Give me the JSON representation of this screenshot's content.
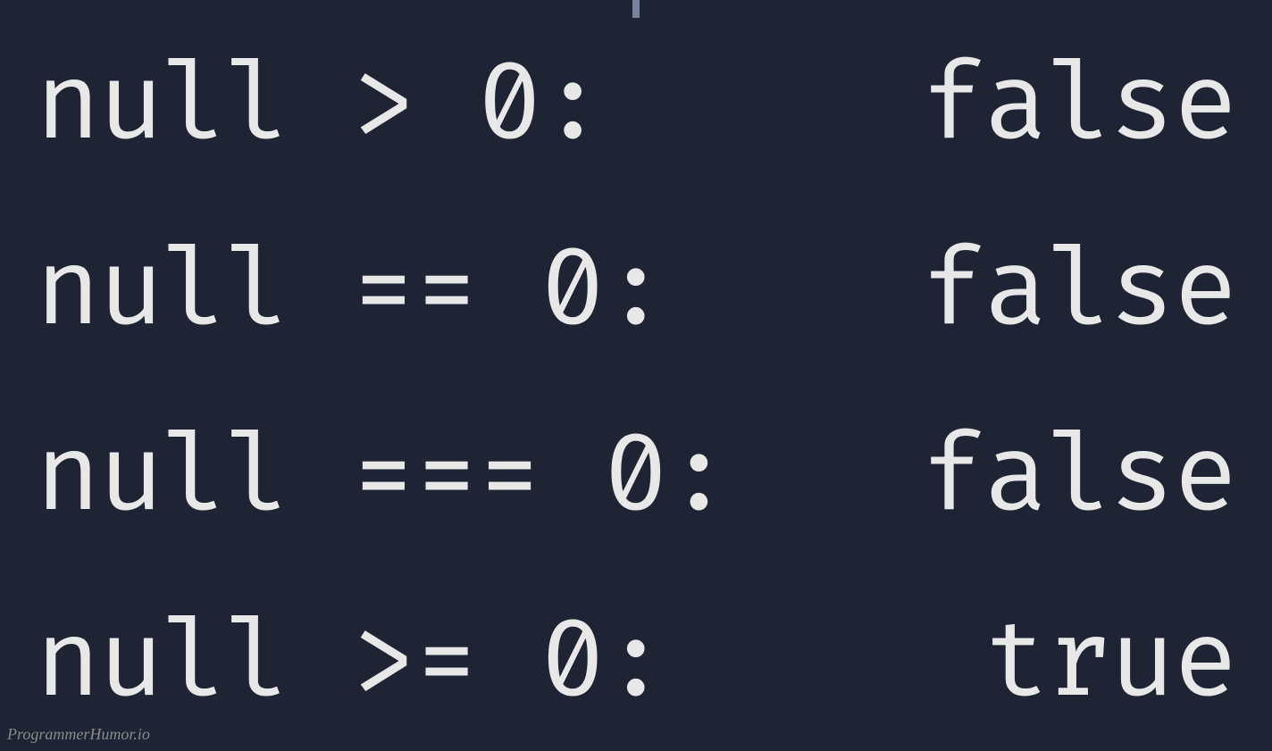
{
  "lines": [
    {
      "expr": "null > 0:",
      "result": "false"
    },
    {
      "expr": "null == 0:",
      "result": "false"
    },
    {
      "expr": "null === 0:",
      "result": "false"
    },
    {
      "expr": "null >= 0:",
      "result": "true"
    }
  ],
  "watermark": "ProgrammerHumor.io"
}
